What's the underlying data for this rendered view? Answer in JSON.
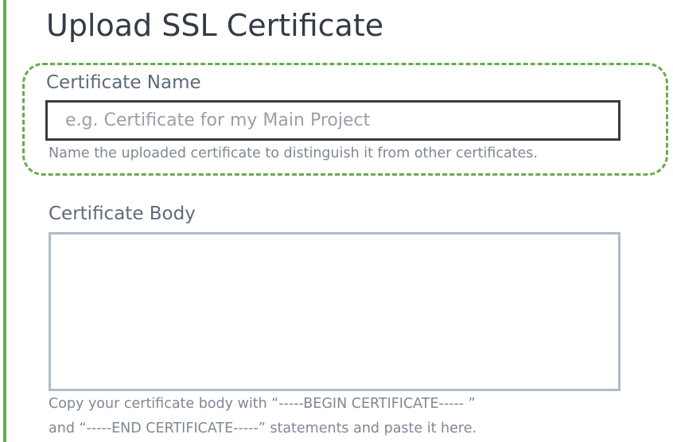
{
  "page_title": "Upload SSL Certificate",
  "colors": {
    "accent": "#6aaa4f",
    "title_text": "#333b45",
    "label_text": "#5e6a7a",
    "help_text": "#7f8893",
    "input_border_focused": "#3a3a3a",
    "textarea_border": "#aebbc9"
  },
  "certificate_name": {
    "label": "Certificate Name",
    "value": "",
    "placeholder": "e.g. Certificate for my Main Project",
    "help": "Name the uploaded certificate to distinguish it from other certificates.",
    "focused": true
  },
  "certificate_body": {
    "label": "Certificate Body",
    "value": "",
    "help_line_1": "Copy your certificate body with “-----BEGIN CERTIFICATE----- ”",
    "help_line_2": "and “-----END CERTIFICATE-----” statements and paste it here."
  }
}
